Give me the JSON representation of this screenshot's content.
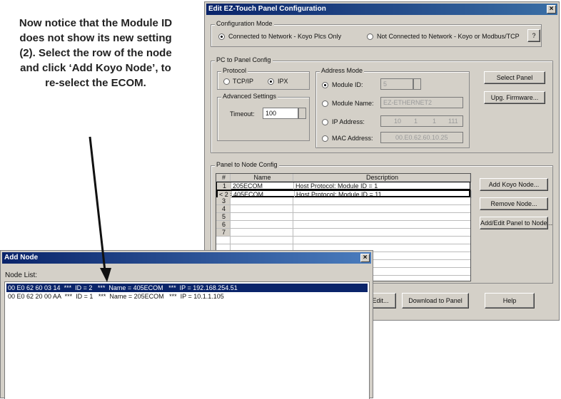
{
  "annotation": {
    "lines": [
      "Now notice that the Module ID",
      "does not show its new setting",
      "(2). Select the row of the node",
      "and click ‘Add Koyo Node’, to",
      "re-select the ECOM."
    ]
  },
  "config_window": {
    "title": "Edit EZ-Touch Panel Configuration",
    "close_label": "×",
    "config_mode": {
      "legend": "Configuration Mode",
      "option_network": "Connected to Network - Koyo Plcs Only",
      "option_not_network": "Not Connected to Network - Koyo or Modbus/TCP",
      "help_button": "?"
    },
    "pc_to_panel": {
      "legend": "PC to Panel Config",
      "protocol_legend": "Protocol",
      "protocol_tcpip": "TCP/IP",
      "protocol_ipx": "IPX",
      "advanced_legend": "Advanced Settings",
      "timeout_label": "Timeout:",
      "timeout_value": "100",
      "address_legend": "Address Mode",
      "module_id_label": "Module ID:",
      "module_id_value": "5",
      "module_name_label": "Module Name:",
      "module_name_value": "EZ-ETHERNET2",
      "ip_label": "IP Address:",
      "ip_parts": [
        "10",
        "1",
        "1",
        "111"
      ],
      "mac_label": "MAC Address:",
      "mac_value": "00.E0.62.60.10.25",
      "select_panel": "Select Panel",
      "upg_firmware": "Upg. Firmware..."
    },
    "panel_to_node": {
      "legend": "Panel to Node Config",
      "col_num": "#",
      "col_name": "Name",
      "col_desc": "Description",
      "rows": [
        {
          "num": "1",
          "name": "205ECOM",
          "desc": "Host Protocol: Module ID = 1"
        },
        {
          "num": "< 2 >",
          "name": "405ECOM",
          "desc": "Host Protocol: Module ID = 11"
        },
        {
          "num": "3",
          "name": "",
          "desc": ""
        },
        {
          "num": "4",
          "name": "",
          "desc": ""
        },
        {
          "num": "5",
          "name": "",
          "desc": ""
        },
        {
          "num": "6",
          "name": "",
          "desc": ""
        },
        {
          "num": "7",
          "name": "",
          "desc": ""
        }
      ],
      "add_koyo_node": "Add Koyo Node...",
      "remove_node": "Remove Node...",
      "add_edit_panel": "Add/Edit Panel to Node..."
    },
    "bottom_buttons": {
      "edit": "Edit...",
      "download": "Download to Panel",
      "help": "Help"
    }
  },
  "add_node_window": {
    "title": "Add Node",
    "close_label": "×",
    "node_list_label": "Node List:",
    "nodes": [
      "00 E0 62 60 03 14  ***  ID = 2   ***  Name = 405ECOM   ***  IP = 192.168.254.51",
      "00 E0 62 20 00 AA  ***  ID = 1   ***  Name = 205ECOM   ***  IP = 10.1.1.105"
    ]
  },
  "colors": {
    "title_bar": "#0a246a",
    "window_face": "#d4d0c8",
    "selection": "#0a246a"
  }
}
